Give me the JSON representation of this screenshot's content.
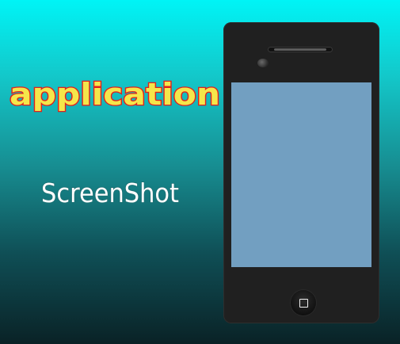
{
  "header": {
    "title": "application",
    "subtitle": "ScreenShot"
  },
  "colors": {
    "title_fill": "#f5e64a",
    "title_stroke": "#e0201e",
    "subtitle_fill": "#ffffff",
    "subtitle_stroke": "#1d6f72",
    "screen": "#729fc1",
    "phone_body": "#202020"
  }
}
